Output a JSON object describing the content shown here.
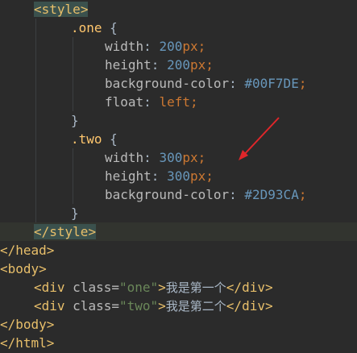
{
  "code": {
    "line1": {
      "open": "<",
      "name": "style",
      "close": ">"
    },
    "line2": {
      "selector": ".one",
      "brace": " {"
    },
    "line3": {
      "prop": "width",
      "colon": ": ",
      "num": "200",
      "unit": "px",
      "semi": ";"
    },
    "line4": {
      "prop": "height",
      "colon": ": ",
      "num": "200",
      "unit": "px",
      "semi": ";"
    },
    "line5": {
      "prop": "background-color",
      "colon": ": ",
      "value": "#00F7DE",
      "semi": ";"
    },
    "line6": {
      "prop": "float",
      "colon": ": ",
      "value": "left",
      "semi": ";"
    },
    "line7": {
      "brace": "}"
    },
    "line8": {
      "selector": ".two",
      "brace": " {"
    },
    "line9": {
      "prop": "width",
      "colon": ": ",
      "num": "300",
      "unit": "px",
      "semi": ";"
    },
    "line10": {
      "prop": "height",
      "colon": ": ",
      "num": "300",
      "unit": "px",
      "semi": ";"
    },
    "line11": {
      "prop": "background-color",
      "colon": ": ",
      "value": "#2D93CA",
      "semi": ";"
    },
    "line12": {
      "brace": "}"
    },
    "line13": {
      "open": "</",
      "name": "style",
      "close": ">"
    },
    "line14": {
      "text": "</head>"
    },
    "line15": {
      "text": "<body>"
    },
    "line16": {
      "open": "<div ",
      "attr": "class=",
      "value": "\"one\"",
      "gt": ">",
      "content": "我是第一个",
      "end": "</div>"
    },
    "line17": {
      "open": "<div ",
      "attr": "class=",
      "value": "\"two\"",
      "gt": ">",
      "content": "我是第二个",
      "end": "</div>"
    },
    "line18": {
      "text": "</body>"
    },
    "line19": {
      "text": "</html>"
    }
  },
  "colors": {
    "background": "#2b2b2b",
    "current_line": "#32342f",
    "tag": "#e8bf6a",
    "selector": "#ffc66d",
    "number": "#6897bb",
    "keyword": "#cc7832",
    "string": "#6a8759",
    "arrow": "#e0262a"
  }
}
